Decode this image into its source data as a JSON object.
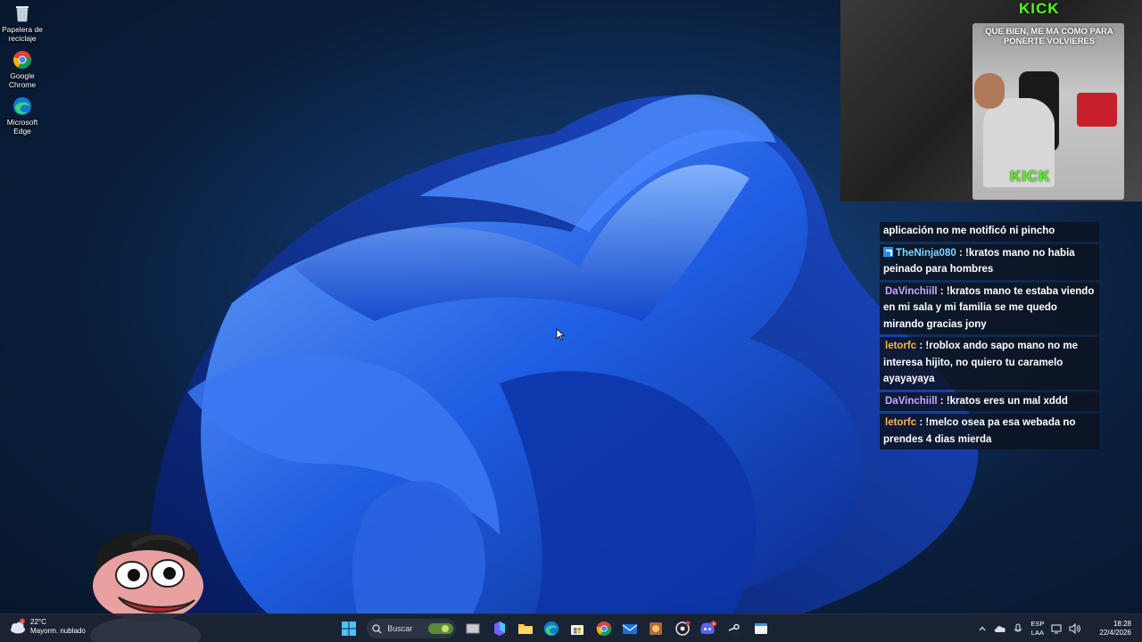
{
  "desktop": {
    "icons": [
      {
        "label": "Papelera de reciclaje",
        "icon": "recycle-bin-icon"
      },
      {
        "label": "Google Chrome",
        "icon": "chrome-icon"
      },
      {
        "label": "Microsoft Edge",
        "icon": "edge-icon"
      }
    ]
  },
  "stream": {
    "overlay_brand_top": "KICK",
    "overlay_brand_bottom": "KICK",
    "overlay_text": "QUE BIEN, ME MA COMO PARA PONERTE VOLVIERES",
    "brand_color": "#53fc18"
  },
  "chat": {
    "messages": [
      {
        "user": "",
        "user_color": "#ffffff",
        "badge": false,
        "separator": "",
        "text": "aplicación no me notificó ni pincho"
      },
      {
        "user": "TheNinja080",
        "user_color": "#7fd6ff",
        "badge": true,
        "separator": " : ",
        "text": "!kratos mano no habia peinado para hombres"
      },
      {
        "user": "DaVinchiill",
        "user_color": "#c9a6ff",
        "badge": false,
        "separator": " : ",
        "text": "!kratos mano te estaba viendo en mi sala y mi familia se me quedo mirando gracias jony"
      },
      {
        "user": "letorfc",
        "user_color": "#ffb347",
        "badge": false,
        "separator": " : ",
        "text": "!roblox ando sapo mano no me interesa hijito, no quiero tu caramelo ayayayaya"
      },
      {
        "user": "DaVinchiill",
        "user_color": "#c9a6ff",
        "badge": false,
        "separator": " : ",
        "text": "!kratos eres un mal xddd"
      },
      {
        "user": "letorfc",
        "user_color": "#ffb347",
        "badge": false,
        "separator": " : ",
        "text": "!melco osea pa esa webada no prendes 4 dias mierda"
      }
    ]
  },
  "taskbar": {
    "weather_temp": "22°C",
    "weather_desc": "Mayorm. nublado",
    "weather_alert": "1",
    "search_label": "Buscar",
    "discord_badge": "5",
    "lang_line1": "ESP",
    "lang_line2": "LAA",
    "time": "18:28",
    "date": "22/4/2026",
    "apps": [
      "windows-start-icon",
      "search-icon",
      "game-widget-icon",
      "task-view-icon",
      "m365-icon",
      "file-explorer-icon",
      "edge-icon",
      "microsoft-store-icon",
      "chrome-icon",
      "mail-icon",
      "game-icon",
      "chatgpt-icon",
      "discord-icon",
      "steam-icon",
      "terminal-icon"
    ]
  }
}
